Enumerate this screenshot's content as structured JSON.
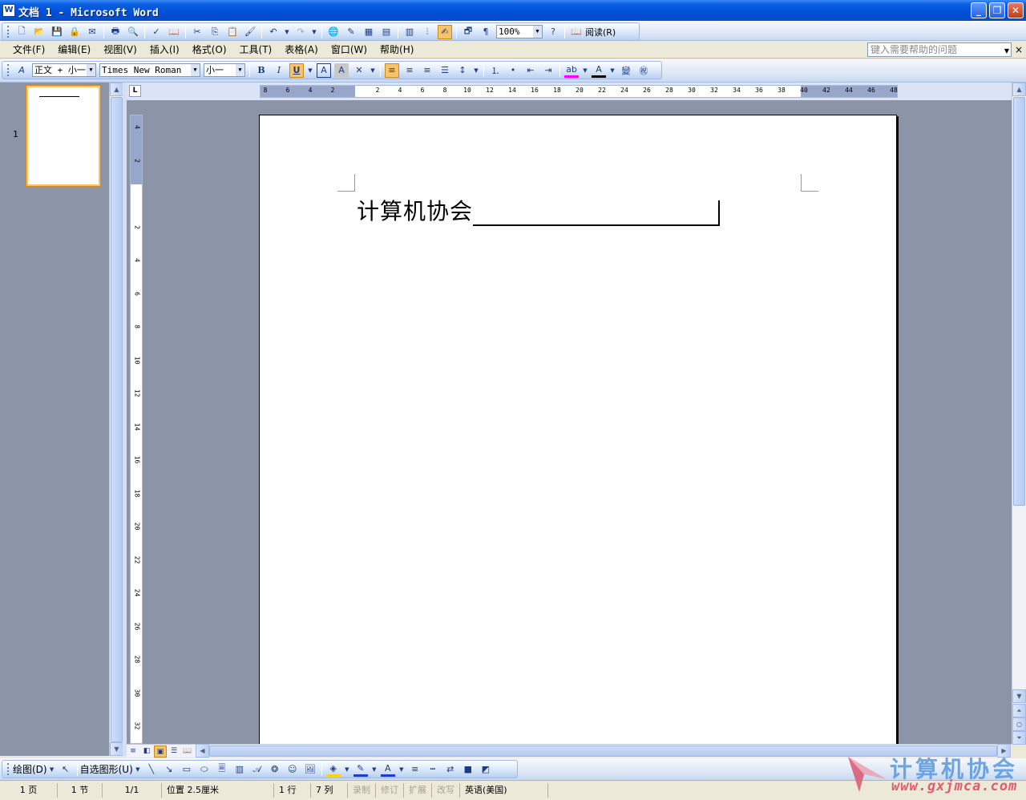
{
  "window": {
    "title": "文档 1 - Microsoft Word",
    "app_icon": "W"
  },
  "titlebar_buttons": {
    "minimize": "_",
    "restore": "❐",
    "close": "✕"
  },
  "toolbar_standard": {
    "zoom": "100%",
    "read_label": "阅读(R)",
    "icons": [
      "new-icon",
      "open-icon",
      "save-icon",
      "permission-icon",
      "print-icon",
      "print-preview-icon",
      "spelling-icon",
      "research-icon",
      "cut-icon",
      "copy-icon",
      "paste-icon",
      "format-painter-icon",
      "undo-icon",
      "redo-icon",
      "hyperlink-icon",
      "tables-borders-icon",
      "insert-table-icon",
      "insert-excel-icon",
      "columns-icon",
      "drawing-icon",
      "document-map-icon",
      "show-hide-icon",
      "help-icon"
    ]
  },
  "menu": {
    "items": [
      "文件(F)",
      "编辑(E)",
      "视图(V)",
      "插入(I)",
      "格式(O)",
      "工具(T)",
      "表格(A)",
      "窗口(W)",
      "帮助(H)"
    ],
    "help_placeholder": "键入需要帮助的问题",
    "close": "×"
  },
  "toolbar_format": {
    "style": "正文 + 小一",
    "font": "Times New Roman",
    "size": "小一",
    "bold": "B",
    "italic": "I",
    "underline": "U"
  },
  "ruler": {
    "h_ticks": [
      "8",
      "6",
      "4",
      "2",
      "",
      "2",
      "4",
      "6",
      "8",
      "10",
      "12",
      "14",
      "16",
      "18",
      "20",
      "22",
      "24",
      "26",
      "28",
      "30",
      "32",
      "34",
      "36",
      "38",
      "40",
      "42",
      "44",
      "46",
      "48"
    ],
    "v_ticks": [
      "4",
      "2",
      "",
      "2",
      "4",
      "6",
      "8",
      "10",
      "12",
      "14",
      "16",
      "18",
      "20",
      "22",
      "24",
      "26",
      "28",
      "30",
      "32"
    ]
  },
  "thumbnail": {
    "page_number": "1"
  },
  "document": {
    "text": "计算机协会"
  },
  "ime_bar": {
    "items": [
      "万",
      "中",
      "☽",
      "°,",
      "▦",
      "网",
      "🔧"
    ]
  },
  "drawing_toolbar": {
    "draw_label": "绘图(D)",
    "autoshapes_label": "自选图形(U)"
  },
  "status": {
    "page": "1 页",
    "section": "1 节",
    "page_of": "1/1",
    "position": "位置 2.5厘米",
    "line": "1 行",
    "column": "7 列",
    "rec": "录制",
    "trk": "修订",
    "ext": "扩展",
    "ovr": "改写",
    "language": "英语(美国)"
  },
  "watermark": {
    "text": "计算机协会",
    "url": "www.gxjmca.com"
  },
  "colors": {
    "title_bar": "#0050d8",
    "workspace": "#8c94a8",
    "accent_orange": "#f7c46b"
  }
}
